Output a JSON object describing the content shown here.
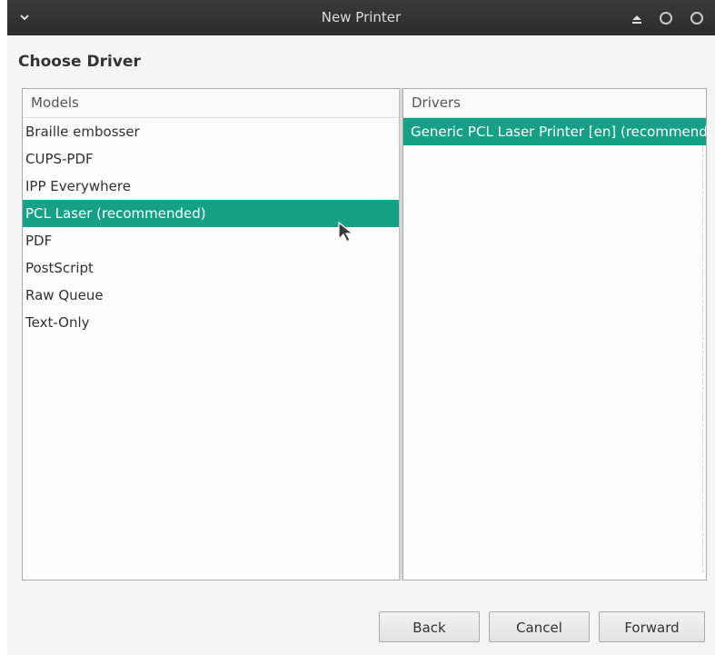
{
  "window": {
    "title": "New Printer"
  },
  "page": {
    "heading": "Choose Driver"
  },
  "models": {
    "header": "Models",
    "items": [
      "Braille embosser",
      "CUPS-PDF",
      "IPP Everywhere",
      "PCL Laser (recommended)",
      "PDF",
      "PostScript",
      "Raw Queue",
      "Text-Only"
    ],
    "selected_index": 3
  },
  "drivers": {
    "header": "Drivers",
    "items": [
      "Generic PCL Laser Printer [en] (recommended)"
    ],
    "selected_index": 0
  },
  "buttons": {
    "back": "Back",
    "cancel": "Cancel",
    "forward": "Forward"
  },
  "icons": {
    "menu": "chevron-down-icon",
    "eject": "eject-icon",
    "window_buttons": [
      "circle-icon",
      "circle-icon"
    ],
    "pointer": "mouse-pointer-icon"
  },
  "colors": {
    "selection": "#16a085",
    "titlebar": "#2f2f2f"
  }
}
